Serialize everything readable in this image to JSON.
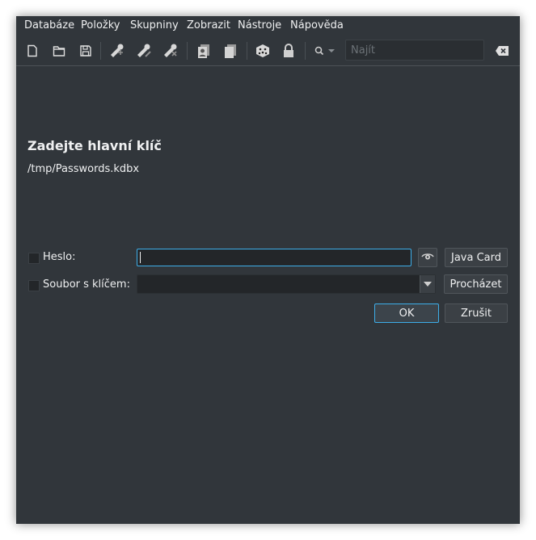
{
  "menu": [
    "Databáze",
    "Položky",
    "Skupniny",
    "Zobrazit",
    "Nástroje",
    "Nápověda"
  ],
  "toolbar": {
    "icons": [
      "new-database-icon",
      "open-database-icon",
      "save-database-icon",
      "add-entry-icon",
      "edit-entry-icon",
      "delete-entry-icon",
      "copy-username-icon",
      "copy-password-icon",
      "password-generator-icon",
      "lock-database-icon"
    ],
    "search_placeholder": "Najít",
    "search_value": ""
  },
  "dialog": {
    "title": "Zadejte hlavní klíč",
    "path": "/tmp/Passwords.kdbx",
    "password_label": "Heslo:",
    "password_value": "",
    "java_card_label": "Java Card",
    "keyfile_label": "Soubor s klíčem:",
    "keyfile_value": "",
    "browse_label": "Procházet",
    "ok_label": "OK",
    "cancel_label": "Zrušit"
  },
  "colors": {
    "background": "#31363b",
    "field": "#232629",
    "accent": "#3daee9",
    "text": "#eff0f1"
  }
}
